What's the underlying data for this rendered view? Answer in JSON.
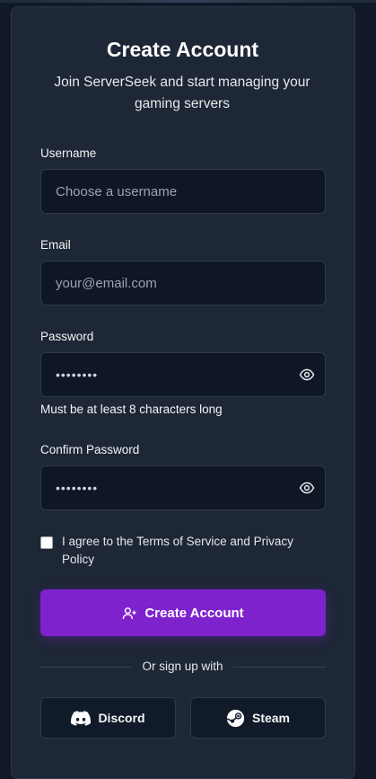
{
  "form": {
    "title": "Create Account",
    "subtitle": "Join ServerSeek and start managing your gaming servers",
    "username": {
      "label": "Username",
      "placeholder": "Choose a username"
    },
    "email": {
      "label": "Email",
      "placeholder": "your@email.com"
    },
    "password": {
      "label": "Password",
      "value": "••••••••",
      "hint": "Must be at least 8 characters long",
      "icon": "eye-icon"
    },
    "confirm_password": {
      "label": "Confirm Password",
      "value": "••••••••",
      "icon": "eye-icon"
    },
    "terms": {
      "label": "I agree to the Terms of Service and Privacy Policy",
      "checked": false
    },
    "submit": {
      "label": "Create Account",
      "icon": "user-plus-icon"
    },
    "divider_text": "Or sign up with",
    "social": [
      {
        "label": "Discord",
        "icon": "discord-icon"
      },
      {
        "label": "Steam",
        "icon": "steam-icon"
      }
    ]
  },
  "colors": {
    "background": "#111827",
    "card": "#1e2736",
    "input": "#0f1726",
    "accent": "#7e22ce"
  }
}
